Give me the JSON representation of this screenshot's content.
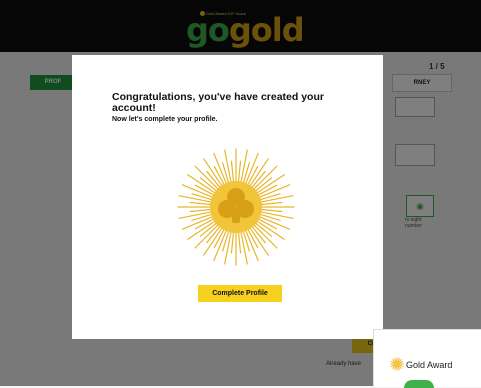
{
  "header": {
    "logo_small_text": "Gold Award DIY Scout",
    "logo_go": "go",
    "logo_gold": "gold"
  },
  "page": {
    "step": "1 / 5",
    "tab_profile": "PROF",
    "tab_journey": "RNEY",
    "password_hint": "rs eight\nnumber",
    "cta_partial": "CR",
    "already_text": "Already have"
  },
  "modal": {
    "title": "Congratulations, you've have created your account!",
    "subtitle": "Now let's complete your profile.",
    "button_label": "Complete Profile"
  },
  "corner_card": {
    "title": "Gold Award"
  },
  "colors": {
    "accent_green": "#1e9a3d",
    "accent_gold": "#d9a317",
    "button_yellow": "#f6d21f"
  }
}
